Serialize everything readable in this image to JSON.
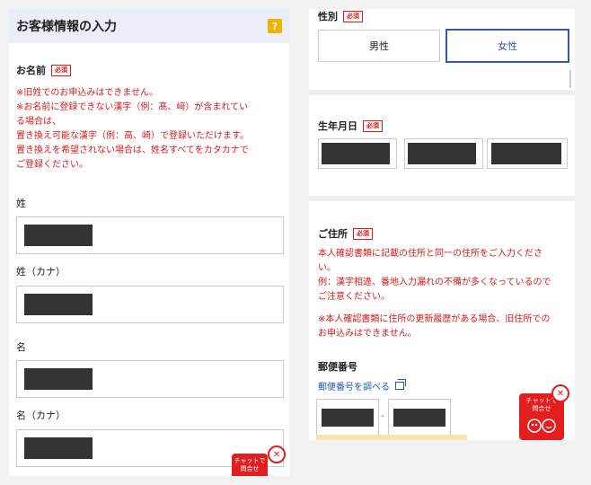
{
  "left": {
    "header_title": "お客様情報の入力",
    "help_icon": "?",
    "name_label": "お名前",
    "required": "必須",
    "notes": [
      "※旧姓でのお申込みはできません。",
      "※お名前に登録できない漢字（例：髙、﨑）が含まれてい",
      "る場合は、",
      "置き換え可能な漢字（例：高、崎）で登録いただけます。",
      "置き換えを希望されない場合は、姓名すべてをカタカナで",
      "ご登録ください。"
    ],
    "fields": {
      "sei": "姓",
      "sei_kana": "姓（カナ）",
      "mei": "名",
      "mei_kana": "名（カナ）"
    },
    "chat": {
      "line1": "チャットで",
      "line2": "問合せ",
      "close": "✕"
    }
  },
  "right": {
    "gender_label": "性別",
    "required": "必須",
    "gender_options": [
      "男性",
      "女性"
    ],
    "selected_gender": "女性",
    "birth_label": "生年月日",
    "address_label": "ご住所",
    "address_notes": [
      "本人確認書類に記載の住所と同一の住所をご入力くださ",
      "い。",
      "例：漢字相違、番地入力漏れの不備が多くなっているので",
      "ご注意ください。"
    ],
    "address_notes2": [
      "※本人確認書類に住所の更新履歴がある場合、旧住所での",
      "お申込みはできません。"
    ],
    "postal_label": "郵便番号",
    "postal_link": "郵便番号を調べる",
    "postal_dash": "-",
    "chat": {
      "line1": "チャットで",
      "line2": "問合せ",
      "close": "✕"
    }
  }
}
